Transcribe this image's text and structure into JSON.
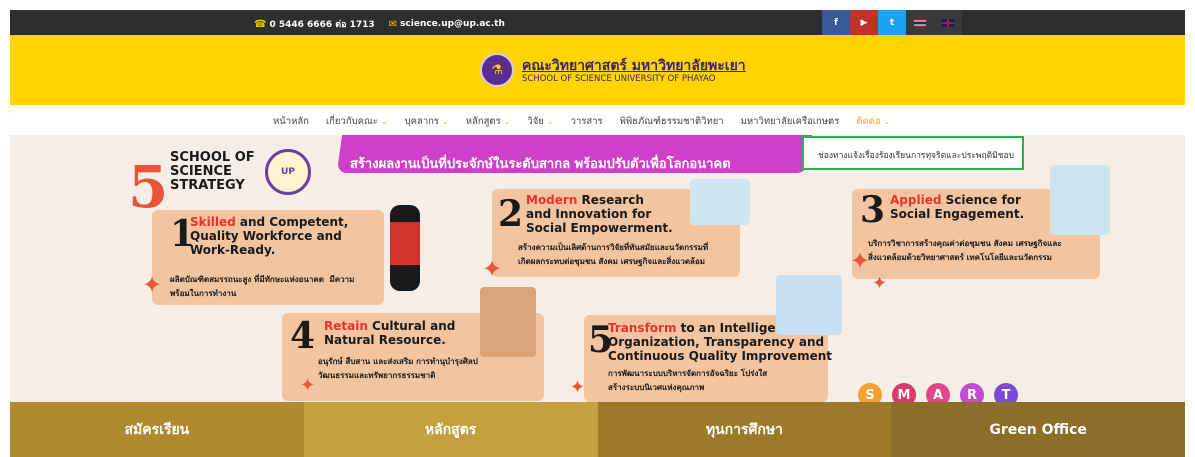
{
  "topbar": {
    "phone": "0 5446 6666 ต่อ 1713",
    "email": "science.up@up.ac.th",
    "social": [
      "f",
      "▶",
      "t"
    ]
  },
  "header": {
    "title_th": "คณะวิทยาศาสตร์ มหาวิทยาลัยพะเยา",
    "title_en": "SCHOOL OF SCIENCE UNIVERSITY OF PHAYAO"
  },
  "nav": {
    "items": [
      "หน้าหลัก",
      "เกี่ยวกับคณะ",
      "บุคลากร",
      "หลักสูตร",
      "วิจัย",
      "วารสาร",
      "พิพิธภัณฑ์ธรรมชาติวิทยา",
      "มหาวิทยาลัยเครือเกษตร",
      "ติดต่อ"
    ]
  },
  "dropdown": {
    "item": "ช่องทางแจ้งเรื่องร้องเรียนการทุจริตและประพฤติมิชอบ"
  },
  "banner": {
    "ribbon": "สร้างผลงานเป็นที่ประจักษ์ในระดับสากล พร้อมปรับตัวเพื่อโลกอนาคต",
    "strategy_number": "5",
    "strategy_title": "SCHOOL OF\nSCIENCE\nSTRATEGY",
    "cards": [
      {
        "num": "1",
        "hl": "Skilled",
        "title": " and Competent,\nQuality Workforce and\nWork-Ready.",
        "desc": "ผลิตบัณฑิตสมรรถนะสูง ที่มีทักษะแห่งอนาคต  มีความ\nพร้อมในการทำงาน"
      },
      {
        "num": "2",
        "hl": "Modern",
        "title": " Research\nand Innovation for\nSocial Empowerment.",
        "desc": "สร้างความเป็นเลิศด้านการวิจัยที่ทันสมัยและนวัตกรรมที่\nเกิดผลกระทบต่อชุมชน สังคม เศรษฐกิจและสิ่งแวดล้อม"
      },
      {
        "num": "3",
        "hl": "Applied",
        "title": " Science for\nSocial Engagement.",
        "desc": "บริการวิชาการสร้างคุณค่าต่อชุมชน สังคม เศรษฐกิจและ\nสิ่งแวดล้อมด้วยวิทยาศาสตร์ เทคโนโลยีและนวัตกรรม"
      },
      {
        "num": "4",
        "hl": "Retain",
        "title": " Cultural and\nNatural Resource.",
        "desc": "อนุรักษ์ สืบสาน และส่งเสริม การทำนุบำรุงศิลป\nวัฒนธรรมและทรัพยากรธรรมชาติ"
      },
      {
        "num": "5",
        "hl": "Transform",
        "title": " to an Intelligent\nOrganization, Transparency and\nContinuous Quality Improvement",
        "desc": "การพัฒนาระบบบริหารจัดการอัจฉริยะ โปร่งใส\nสร้างระบบนิเวศแห่งคุณภาพ"
      }
    ],
    "smart": [
      "S",
      "M",
      "A",
      "R",
      "T"
    ]
  },
  "bottom_tabs": [
    "สมัครเรียน",
    "หลักสูตร",
    "ทุนการศึกษา",
    "Green Office"
  ],
  "colors": {
    "topbar": "#2e2e2e",
    "header": "#ffd400",
    "accent": "#f0b400",
    "card": "#f3c4a0",
    "highlight": "#e8342a",
    "ribbon": "#cf3fc7",
    "bottom": [
      "#b08a2e",
      "#c6a040",
      "#9c7a2c",
      "#8c6e28"
    ],
    "smart": [
      "#f2a233",
      "#d93b6a",
      "#e0478a",
      "#c24bd0",
      "#7b4ad6"
    ]
  }
}
